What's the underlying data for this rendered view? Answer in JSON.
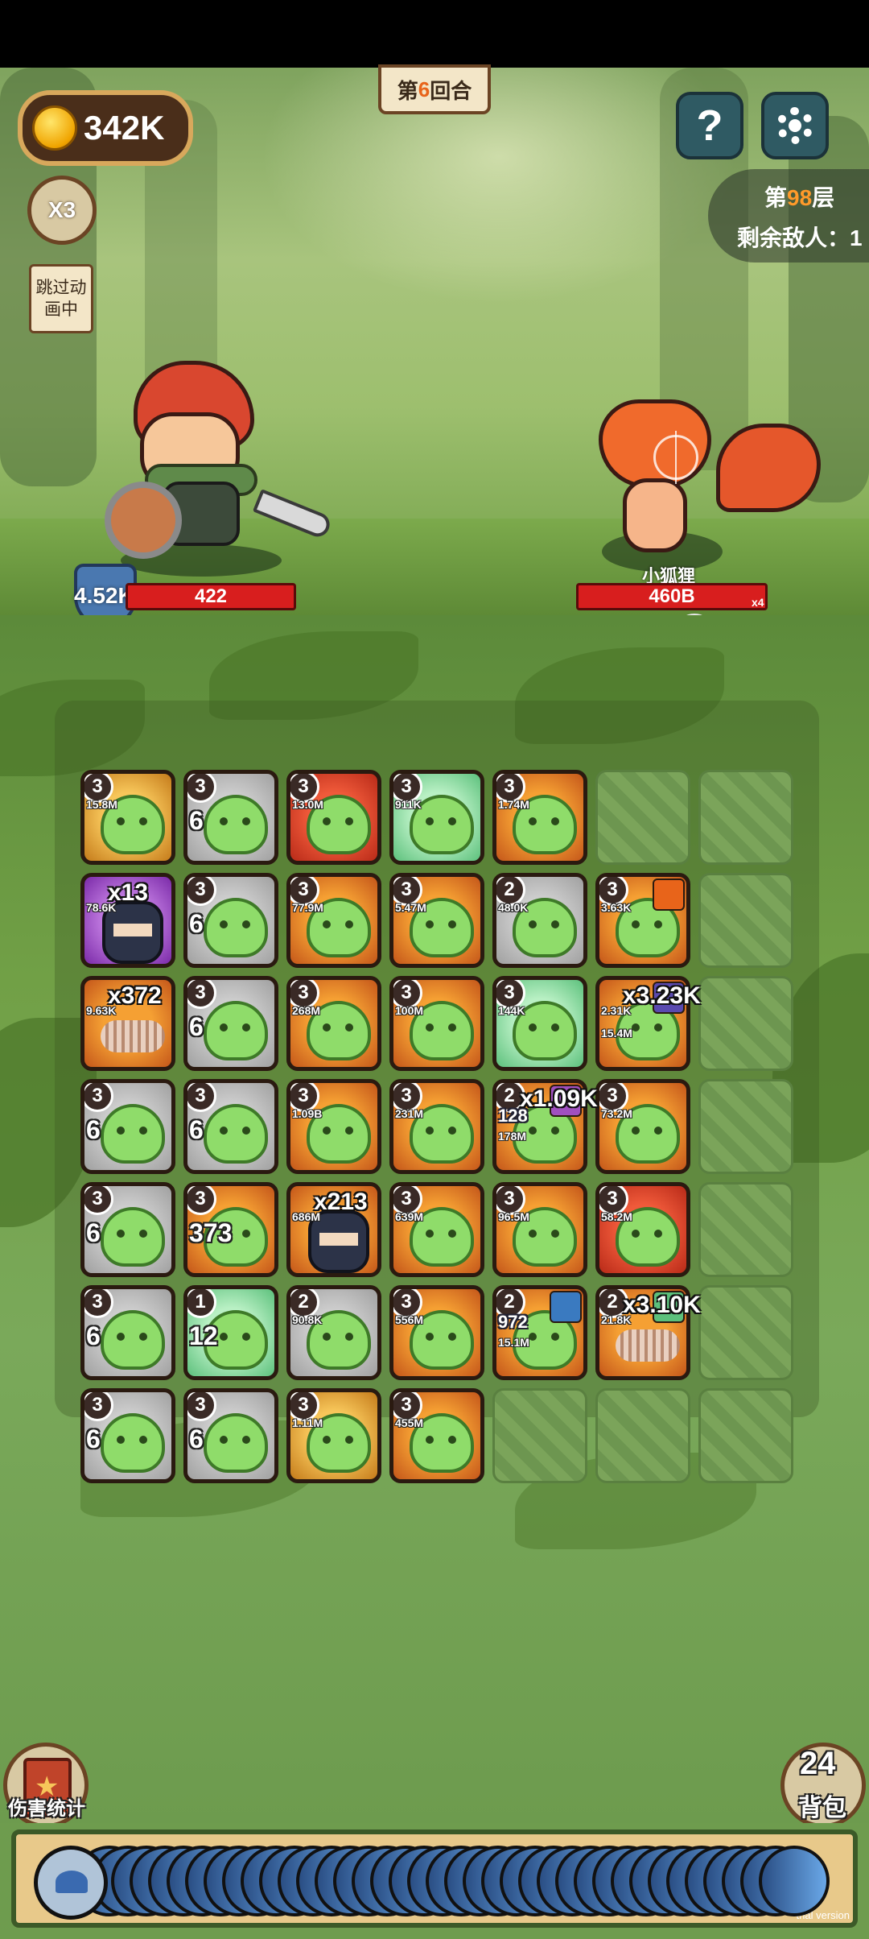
{
  "hud": {
    "coins": "342K",
    "round": {
      "prefix": "第",
      "number": "6",
      "suffix": "回合"
    },
    "speed": "X3",
    "skip_label": "跳过动画中",
    "floor": {
      "prefix": "第",
      "number": "98",
      "suffix": "层"
    },
    "enemies_left": "剩余敌人：1",
    "help_label": "?"
  },
  "player": {
    "armor": "4.52K",
    "hp": "422",
    "buffs": [
      "feather-icon",
      "puzzle-icon"
    ]
  },
  "enemy": {
    "name": "小狐狸",
    "hp": "460B",
    "multiplier": "x4",
    "buffs": [
      "dagger-icon",
      "crab-icon"
    ]
  },
  "board": {
    "rows": [
      [
        {
          "color": "gold",
          "unit": "slime",
          "level": "3",
          "dmg": "15.8M"
        },
        {
          "color": "gray",
          "unit": "slime",
          "level": "3",
          "count": "6"
        },
        {
          "color": "red",
          "unit": "slime",
          "level": "3",
          "dmg": "13.0M"
        },
        {
          "color": "green",
          "unit": "slime",
          "level": "3",
          "dmg": "911K"
        },
        {
          "color": "orange",
          "unit": "slime",
          "level": "3",
          "dmg": "1.74M"
        },
        {
          "empty": true
        },
        {
          "empty": true
        }
      ],
      [
        {
          "color": "purple",
          "unit": "ninja",
          "level": "",
          "dmg": "78.6K",
          "overlay": "x13"
        },
        {
          "color": "gray",
          "unit": "slime",
          "level": "3",
          "count": "6"
        },
        {
          "color": "orange",
          "unit": "slime",
          "level": "3",
          "dmg": "77.9M"
        },
        {
          "color": "orange",
          "unit": "slime",
          "level": "3",
          "dmg": "5.47M"
        },
        {
          "color": "gray",
          "unit": "slime",
          "level": "2",
          "dmg": "48.0K"
        },
        {
          "color": "orange",
          "unit": "slime",
          "level": "3",
          "dmg": "3.63K",
          "badge": "#e8641a"
        },
        {
          "empty": true
        }
      ],
      [
        {
          "color": "orange",
          "unit": "spring",
          "level": "",
          "dmg": "9.63K",
          "overlay": "x372"
        },
        {
          "color": "gray",
          "unit": "slime",
          "level": "3",
          "count": "6"
        },
        {
          "color": "orange",
          "unit": "slime",
          "level": "3",
          "dmg": "268M"
        },
        {
          "color": "orange",
          "unit": "slime",
          "level": "3",
          "dmg": "100M"
        },
        {
          "color": "green",
          "unit": "slime",
          "level": "3",
          "dmg": "144K"
        },
        {
          "color": "orange",
          "unit": "slime",
          "level": "",
          "dmg": "2.31K",
          "dmg2": "15.4M",
          "overlay": "x3.23K",
          "badge": "#5a4ab0"
        },
        {
          "empty": true
        }
      ],
      [
        {
          "color": "gray",
          "unit": "slime",
          "level": "3",
          "count": "6"
        },
        {
          "color": "gray",
          "unit": "slime",
          "level": "3",
          "count": "6"
        },
        {
          "color": "orange",
          "unit": "slime",
          "level": "3",
          "dmg": "1.09B"
        },
        {
          "color": "orange",
          "unit": "slime",
          "level": "3",
          "dmg": "231M"
        },
        {
          "color": "orange",
          "unit": "slime",
          "level": "2",
          "num": "128",
          "dmg2": "178M",
          "overlay": "x1.09K",
          "badge": "#a050c0"
        },
        {
          "color": "orange",
          "unit": "slime",
          "level": "3",
          "dmg": "73.2M"
        },
        {
          "empty": true
        }
      ],
      [
        {
          "color": "gray",
          "unit": "slime",
          "level": "3",
          "count": "6"
        },
        {
          "color": "orange",
          "unit": "slime",
          "level": "3",
          "count": "373"
        },
        {
          "color": "orange",
          "unit": "ninja",
          "level": "",
          "dmg": "686M",
          "overlay": "x213"
        },
        {
          "color": "orange",
          "unit": "slime",
          "level": "3",
          "dmg": "639M"
        },
        {
          "color": "orange",
          "unit": "slime",
          "level": "3",
          "dmg": "96.5M"
        },
        {
          "color": "red",
          "unit": "slime",
          "level": "3",
          "dmg": "58.2M"
        },
        {
          "empty": true
        }
      ],
      [
        {
          "color": "gray",
          "unit": "slime",
          "level": "3",
          "count": "6"
        },
        {
          "color": "green",
          "unit": "slime",
          "level": "1",
          "count": "12"
        },
        {
          "color": "gray",
          "unit": "slime",
          "level": "2",
          "dmg": "90.8K"
        },
        {
          "color": "orange",
          "unit": "slime",
          "level": "3",
          "dmg": "556M"
        },
        {
          "color": "orange",
          "unit": "slime",
          "level": "2",
          "num": "972",
          "dmg2": "15.1M",
          "badge": "#3a7ac0"
        },
        {
          "color": "orange",
          "unit": "spring",
          "level": "2",
          "dmg": "21.8K",
          "overlay": "x3.10K",
          "badge": "#5cc07c"
        },
        {
          "empty": true
        }
      ],
      [
        {
          "color": "gray",
          "unit": "slime",
          "level": "3",
          "count": "6"
        },
        {
          "color": "gray",
          "unit": "slime",
          "level": "3",
          "count": "6"
        },
        {
          "color": "gold",
          "unit": "slime",
          "level": "3",
          "dmg": "1.11M"
        },
        {
          "color": "orange",
          "unit": "slime",
          "level": "3",
          "dmg": "455M"
        },
        {
          "empty": true
        },
        {
          "empty": true
        },
        {
          "empty": true
        }
      ]
    ]
  },
  "footer": {
    "damage_stats_label": "伤害统计",
    "bag_count": "24",
    "bag_label": "背包",
    "queue_discs": 38,
    "trial": "trial version"
  }
}
